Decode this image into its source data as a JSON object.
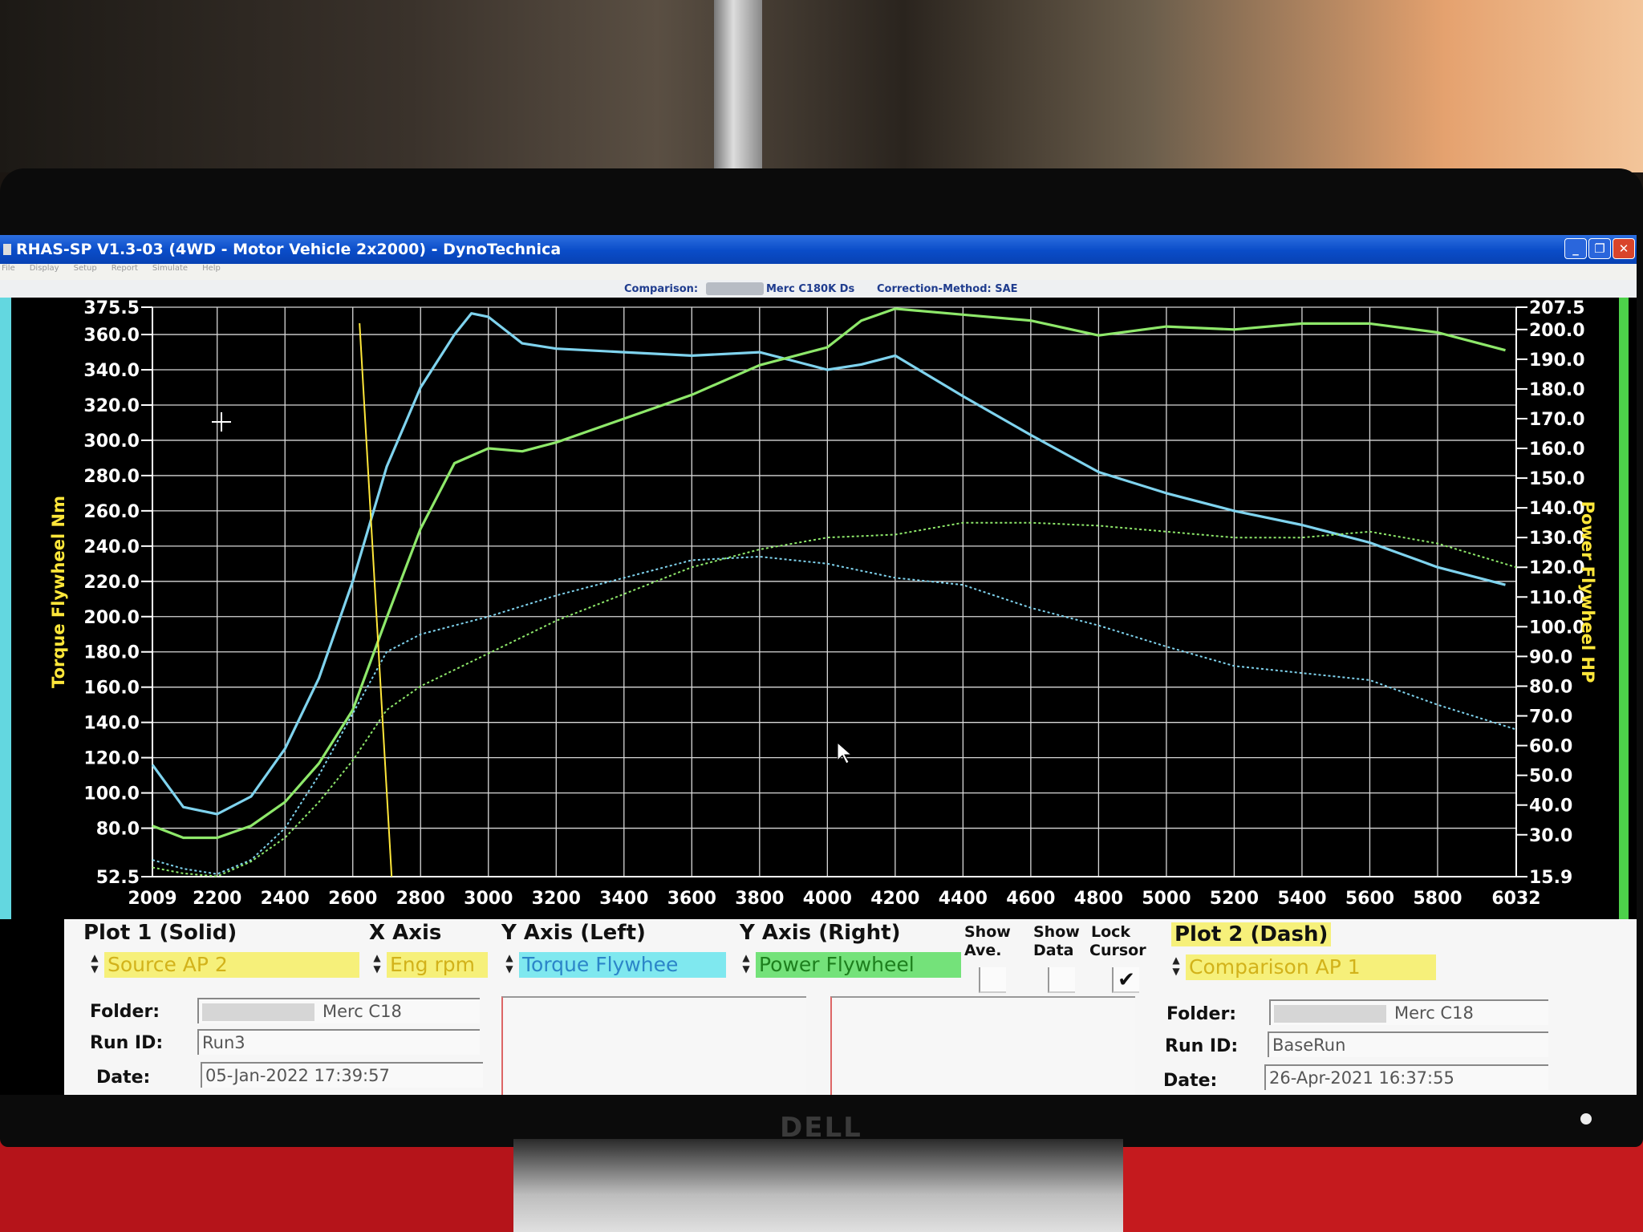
{
  "window": {
    "title": "RHAS-SP V1.3-03  (4WD - Motor Vehicle 2x2000) - DynoTechnica",
    "menu": [
      "File",
      "Display",
      "Setup",
      "Report",
      "Simulate",
      "Help"
    ],
    "controls": {
      "minimize": "_",
      "restore": "❐",
      "close": "✕"
    }
  },
  "infobar": {
    "comparison_label": "Comparison:",
    "vehicle": "Merc C180K Ds",
    "correction": "Correction-Method: SAE"
  },
  "monitor": {
    "brand": "DELL"
  },
  "chart_data": {
    "type": "line",
    "x_label": "",
    "x_ticks": [
      "2009",
      "2200",
      "2400",
      "2600",
      "2800",
      "3000",
      "3200",
      "3400",
      "3600",
      "3800",
      "4000",
      "4200",
      "4400",
      "4600",
      "4800",
      "5000",
      "5200",
      "5400",
      "5600",
      "5800",
      "6032"
    ],
    "xlim": [
      2009,
      6032
    ],
    "y_left_label": "Torque Flywheel Nm",
    "y_left_ticks": [
      "52.5",
      "80.0",
      "100.0",
      "120.0",
      "140.0",
      "160.0",
      "180.0",
      "200.0",
      "220.0",
      "240.0",
      "260.0",
      "280.0",
      "300.0",
      "320.0",
      "340.0",
      "360.0",
      "375.5"
    ],
    "y_left_lim": [
      52.5,
      375.5
    ],
    "y_right_label": "Power Flywheel HP",
    "y_right_ticks": [
      "15.9",
      "30.0",
      "40.0",
      "50.0",
      "60.0",
      "70.0",
      "80.0",
      "90.0",
      "100.0",
      "110.0",
      "120.0",
      "130.0",
      "140.0",
      "150.0",
      "160.0",
      "170.0",
      "180.0",
      "190.0",
      "200.0",
      "207.5"
    ],
    "y_right_lim": [
      15.9,
      207.5
    ],
    "cursor_rpm": 2620,
    "grid": true,
    "colors": {
      "torque": "#7fd3ee",
      "power": "#8ee86a",
      "cursor": "#ffe73a",
      "axis": "#ffffff",
      "axis_label": "#ffe73a"
    },
    "series": [
      {
        "name": "Torque Flywheel",
        "axis": "left",
        "style": "solid",
        "x": [
          2009,
          2100,
          2200,
          2300,
          2400,
          2500,
          2600,
          2700,
          2800,
          2900,
          2950,
          3000,
          3100,
          3200,
          3400,
          3600,
          3800,
          3900,
          4000,
          4100,
          4200,
          4400,
          4600,
          4800,
          5000,
          5200,
          5400,
          5600,
          5800,
          6000
        ],
        "y": [
          116,
          92,
          88,
          98,
          125,
          165,
          220,
          285,
          330,
          360,
          372,
          370,
          355,
          352,
          350,
          348,
          350,
          345,
          340,
          343,
          348,
          325,
          303,
          282,
          270,
          260,
          252,
          242,
          228,
          218
        ]
      },
      {
        "name": "Power Flywheel",
        "axis": "right",
        "style": "solid",
        "x": [
          2009,
          2100,
          2200,
          2300,
          2400,
          2500,
          2600,
          2700,
          2800,
          2900,
          3000,
          3100,
          3200,
          3400,
          3600,
          3800,
          4000,
          4100,
          4200,
          4400,
          4600,
          4800,
          5000,
          5200,
          5400,
          5600,
          5800,
          5900,
          6000
        ],
        "y": [
          33,
          29,
          29,
          33,
          41,
          54,
          72,
          103,
          133,
          155,
          160,
          159,
          162,
          170,
          178,
          188,
          194,
          203,
          207,
          205,
          203,
          198,
          201,
          200,
          202,
          202,
          199,
          196,
          193
        ]
      },
      {
        "name": "Comparison Torque",
        "axis": "left",
        "style": "dash",
        "x": [
          2009,
          2100,
          2200,
          2300,
          2400,
          2500,
          2600,
          2700,
          2800,
          2900,
          3000,
          3200,
          3400,
          3600,
          3800,
          4000,
          4200,
          4400,
          4600,
          4800,
          5000,
          5200,
          5400,
          5600,
          5800,
          6032
        ],
        "y": [
          62,
          57,
          54,
          62,
          80,
          110,
          145,
          180,
          190,
          195,
          200,
          212,
          222,
          232,
          234,
          230,
          222,
          218,
          205,
          195,
          183,
          172,
          168,
          164,
          150,
          136
        ]
      },
      {
        "name": "Comparison Power",
        "axis": "right",
        "style": "dash",
        "x": [
          2009,
          2100,
          2200,
          2300,
          2400,
          2500,
          2600,
          2700,
          2800,
          3000,
          3200,
          3400,
          3600,
          3800,
          4000,
          4200,
          4400,
          4600,
          4800,
          5000,
          5200,
          5400,
          5600,
          5800,
          6032
        ],
        "y": [
          19,
          17,
          16,
          21,
          29,
          41,
          55,
          72,
          80,
          91,
          102,
          111,
          120,
          126,
          130,
          131,
          135,
          135,
          134,
          132,
          130,
          130,
          132,
          128,
          120
        ]
      }
    ]
  },
  "panel": {
    "plot1": {
      "heading": "Plot 1 (Solid)",
      "source": "Source AP 2",
      "folder_label": "Folder:",
      "folder": "Merc C18",
      "run_label": "Run ID:",
      "run": "Run3",
      "date_label": "Date:",
      "date": "05-Jan-2022   17:39:57"
    },
    "x_axis": {
      "heading": "X Axis",
      "value": "Eng rpm"
    },
    "y_left": {
      "heading": "Y Axis (Left)",
      "value": "Torque Flywhee"
    },
    "y_right": {
      "heading": "Y Axis (Right)",
      "value": "Power Flywheel"
    },
    "show_ave": {
      "line1": "Show",
      "line2": "Ave.",
      "checked": false
    },
    "show_data": {
      "line1": "Show",
      "line2": "Data",
      "checked": false
    },
    "lock_cursor": {
      "line1": "Lock",
      "line2": "Cursor",
      "checked": true,
      "mark": "✔"
    },
    "plot2": {
      "heading": "Plot 2 (Dash)",
      "source": "Comparison AP 1",
      "folder_label": "Folder:",
      "folder": "Merc C18",
      "run_label": "Run ID:",
      "run": "BaseRun",
      "date_label": "Date:",
      "date": "26-Apr-2021   16:37:55"
    }
  }
}
